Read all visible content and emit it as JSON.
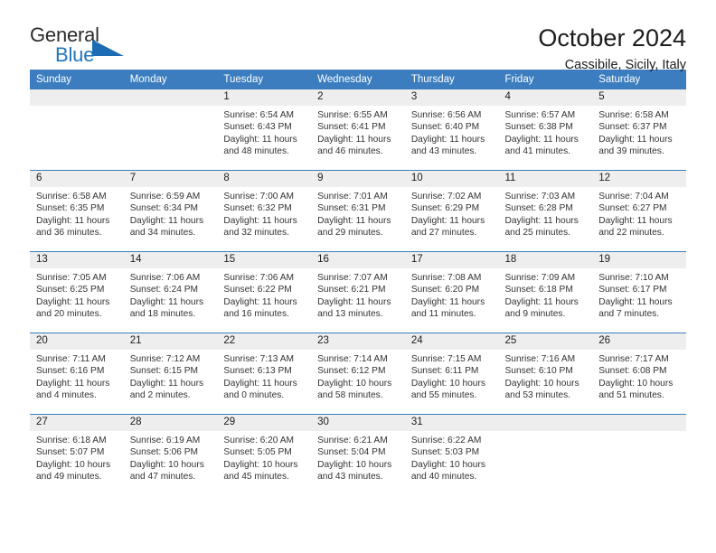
{
  "logo": {
    "word_top": "General",
    "word_bottom": "Blue",
    "accent_color": "#1b6cb3"
  },
  "header": {
    "month_title": "October 2024",
    "location": "Cassibile, Sicily, Italy"
  },
  "theme": {
    "header_blue": "#3b7dbf",
    "daynum_bg": "#eeeeee"
  },
  "weekday_headers": [
    "Sunday",
    "Monday",
    "Tuesday",
    "Wednesday",
    "Thursday",
    "Friday",
    "Saturday"
  ],
  "labels": {
    "sunrise_prefix": "Sunrise:",
    "sunset_prefix": "Sunset:",
    "daylight_prefix": "Daylight:"
  },
  "weeks": [
    [
      {
        "day": "",
        "empty": true
      },
      {
        "day": "",
        "empty": true
      },
      {
        "day": "1",
        "sunrise": "Sunrise: 6:54 AM",
        "sunset": "Sunset: 6:43 PM",
        "daylight_1": "Daylight: 11 hours",
        "daylight_2": "and 48 minutes."
      },
      {
        "day": "2",
        "sunrise": "Sunrise: 6:55 AM",
        "sunset": "Sunset: 6:41 PM",
        "daylight_1": "Daylight: 11 hours",
        "daylight_2": "and 46 minutes."
      },
      {
        "day": "3",
        "sunrise": "Sunrise: 6:56 AM",
        "sunset": "Sunset: 6:40 PM",
        "daylight_1": "Daylight: 11 hours",
        "daylight_2": "and 43 minutes."
      },
      {
        "day": "4",
        "sunrise": "Sunrise: 6:57 AM",
        "sunset": "Sunset: 6:38 PM",
        "daylight_1": "Daylight: 11 hours",
        "daylight_2": "and 41 minutes."
      },
      {
        "day": "5",
        "sunrise": "Sunrise: 6:58 AM",
        "sunset": "Sunset: 6:37 PM",
        "daylight_1": "Daylight: 11 hours",
        "daylight_2": "and 39 minutes."
      }
    ],
    [
      {
        "day": "6",
        "sunrise": "Sunrise: 6:58 AM",
        "sunset": "Sunset: 6:35 PM",
        "daylight_1": "Daylight: 11 hours",
        "daylight_2": "and 36 minutes."
      },
      {
        "day": "7",
        "sunrise": "Sunrise: 6:59 AM",
        "sunset": "Sunset: 6:34 PM",
        "daylight_1": "Daylight: 11 hours",
        "daylight_2": "and 34 minutes."
      },
      {
        "day": "8",
        "sunrise": "Sunrise: 7:00 AM",
        "sunset": "Sunset: 6:32 PM",
        "daylight_1": "Daylight: 11 hours",
        "daylight_2": "and 32 minutes."
      },
      {
        "day": "9",
        "sunrise": "Sunrise: 7:01 AM",
        "sunset": "Sunset: 6:31 PM",
        "daylight_1": "Daylight: 11 hours",
        "daylight_2": "and 29 minutes."
      },
      {
        "day": "10",
        "sunrise": "Sunrise: 7:02 AM",
        "sunset": "Sunset: 6:29 PM",
        "daylight_1": "Daylight: 11 hours",
        "daylight_2": "and 27 minutes."
      },
      {
        "day": "11",
        "sunrise": "Sunrise: 7:03 AM",
        "sunset": "Sunset: 6:28 PM",
        "daylight_1": "Daylight: 11 hours",
        "daylight_2": "and 25 minutes."
      },
      {
        "day": "12",
        "sunrise": "Sunrise: 7:04 AM",
        "sunset": "Sunset: 6:27 PM",
        "daylight_1": "Daylight: 11 hours",
        "daylight_2": "and 22 minutes."
      }
    ],
    [
      {
        "day": "13",
        "sunrise": "Sunrise: 7:05 AM",
        "sunset": "Sunset: 6:25 PM",
        "daylight_1": "Daylight: 11 hours",
        "daylight_2": "and 20 minutes."
      },
      {
        "day": "14",
        "sunrise": "Sunrise: 7:06 AM",
        "sunset": "Sunset: 6:24 PM",
        "daylight_1": "Daylight: 11 hours",
        "daylight_2": "and 18 minutes."
      },
      {
        "day": "15",
        "sunrise": "Sunrise: 7:06 AM",
        "sunset": "Sunset: 6:22 PM",
        "daylight_1": "Daylight: 11 hours",
        "daylight_2": "and 16 minutes."
      },
      {
        "day": "16",
        "sunrise": "Sunrise: 7:07 AM",
        "sunset": "Sunset: 6:21 PM",
        "daylight_1": "Daylight: 11 hours",
        "daylight_2": "and 13 minutes."
      },
      {
        "day": "17",
        "sunrise": "Sunrise: 7:08 AM",
        "sunset": "Sunset: 6:20 PM",
        "daylight_1": "Daylight: 11 hours",
        "daylight_2": "and 11 minutes."
      },
      {
        "day": "18",
        "sunrise": "Sunrise: 7:09 AM",
        "sunset": "Sunset: 6:18 PM",
        "daylight_1": "Daylight: 11 hours",
        "daylight_2": "and 9 minutes."
      },
      {
        "day": "19",
        "sunrise": "Sunrise: 7:10 AM",
        "sunset": "Sunset: 6:17 PM",
        "daylight_1": "Daylight: 11 hours",
        "daylight_2": "and 7 minutes."
      }
    ],
    [
      {
        "day": "20",
        "sunrise": "Sunrise: 7:11 AM",
        "sunset": "Sunset: 6:16 PM",
        "daylight_1": "Daylight: 11 hours",
        "daylight_2": "and 4 minutes."
      },
      {
        "day": "21",
        "sunrise": "Sunrise: 7:12 AM",
        "sunset": "Sunset: 6:15 PM",
        "daylight_1": "Daylight: 11 hours",
        "daylight_2": "and 2 minutes."
      },
      {
        "day": "22",
        "sunrise": "Sunrise: 7:13 AM",
        "sunset": "Sunset: 6:13 PM",
        "daylight_1": "Daylight: 11 hours",
        "daylight_2": "and 0 minutes."
      },
      {
        "day": "23",
        "sunrise": "Sunrise: 7:14 AM",
        "sunset": "Sunset: 6:12 PM",
        "daylight_1": "Daylight: 10 hours",
        "daylight_2": "and 58 minutes."
      },
      {
        "day": "24",
        "sunrise": "Sunrise: 7:15 AM",
        "sunset": "Sunset: 6:11 PM",
        "daylight_1": "Daylight: 10 hours",
        "daylight_2": "and 55 minutes."
      },
      {
        "day": "25",
        "sunrise": "Sunrise: 7:16 AM",
        "sunset": "Sunset: 6:10 PM",
        "daylight_1": "Daylight: 10 hours",
        "daylight_2": "and 53 minutes."
      },
      {
        "day": "26",
        "sunrise": "Sunrise: 7:17 AM",
        "sunset": "Sunset: 6:08 PM",
        "daylight_1": "Daylight: 10 hours",
        "daylight_2": "and 51 minutes."
      }
    ],
    [
      {
        "day": "27",
        "sunrise": "Sunrise: 6:18 AM",
        "sunset": "Sunset: 5:07 PM",
        "daylight_1": "Daylight: 10 hours",
        "daylight_2": "and 49 minutes."
      },
      {
        "day": "28",
        "sunrise": "Sunrise: 6:19 AM",
        "sunset": "Sunset: 5:06 PM",
        "daylight_1": "Daylight: 10 hours",
        "daylight_2": "and 47 minutes."
      },
      {
        "day": "29",
        "sunrise": "Sunrise: 6:20 AM",
        "sunset": "Sunset: 5:05 PM",
        "daylight_1": "Daylight: 10 hours",
        "daylight_2": "and 45 minutes."
      },
      {
        "day": "30",
        "sunrise": "Sunrise: 6:21 AM",
        "sunset": "Sunset: 5:04 PM",
        "daylight_1": "Daylight: 10 hours",
        "daylight_2": "and 43 minutes."
      },
      {
        "day": "31",
        "sunrise": "Sunrise: 6:22 AM",
        "sunset": "Sunset: 5:03 PM",
        "daylight_1": "Daylight: 10 hours",
        "daylight_2": "and 40 minutes."
      },
      {
        "day": "",
        "empty": true
      },
      {
        "day": "",
        "empty": true
      }
    ]
  ]
}
